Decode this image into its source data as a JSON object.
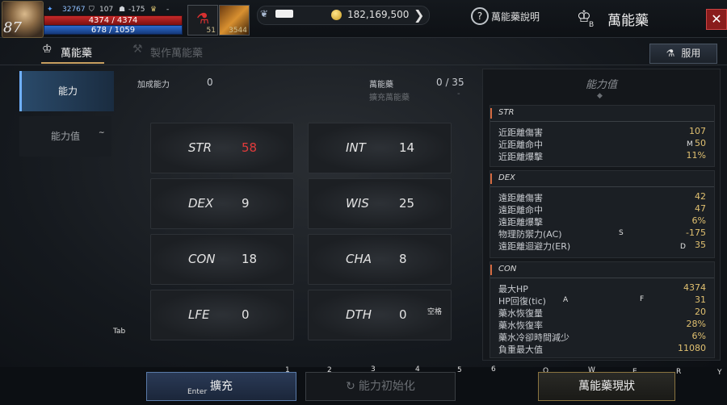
{
  "player": {
    "level": "87",
    "stat_a": "32767",
    "stat_b": "107",
    "stat_c": "-175",
    "stat_d": "-",
    "hp": "4374 / 4374",
    "mp": "678 / 1059"
  },
  "slots": [
    {
      "count": "51"
    },
    {
      "count": "3544"
    }
  ],
  "currency": {
    "gold": "182,169,500"
  },
  "header": {
    "help_label": "萬能藥說明",
    "title": "萬能藥",
    "close": "✕"
  },
  "tabs": {
    "active": "萬能藥",
    "inactive": "製作萬能藥",
    "use_button": "服用"
  },
  "sidenav": [
    {
      "label": "能力"
    },
    {
      "label": "能力值"
    }
  ],
  "info": {
    "bonus_label": "加成能力",
    "bonus_value": "0",
    "elixir_label": "萬能藥",
    "elixir_value": "0 / 35",
    "expand_label": "擴充萬能藥",
    "expand_value": "-"
  },
  "stats": [
    {
      "key": "STR",
      "value": "58"
    },
    {
      "key": "INT",
      "value": "14"
    },
    {
      "key": "DEX",
      "value": "9"
    },
    {
      "key": "WIS",
      "value": "25"
    },
    {
      "key": "CON",
      "value": "18"
    },
    {
      "key": "CHA",
      "value": "8"
    },
    {
      "key": "LFE",
      "value": "0"
    },
    {
      "key": "DTH",
      "value": "0"
    }
  ],
  "panel": {
    "title": "能力值",
    "sections": [
      {
        "name": "STR",
        "rows": [
          {
            "n": "近距離傷害",
            "v": "107"
          },
          {
            "n": "近距離命中",
            "v": "50"
          },
          {
            "n": "近距離爆擊",
            "v": "11%"
          }
        ]
      },
      {
        "name": "DEX",
        "rows": [
          {
            "n": "遠距離傷害",
            "v": "42"
          },
          {
            "n": "遠距離命中",
            "v": "47"
          },
          {
            "n": "遠距離爆擊",
            "v": "6%"
          },
          {
            "n": "物理防禦力(AC)",
            "v": "-175"
          },
          {
            "n": "遠距離迴避力(ER)",
            "v": "35"
          }
        ]
      },
      {
        "name": "CON",
        "rows": [
          {
            "n": "最大HP",
            "v": "4374"
          },
          {
            "n": "HP回復(tic)",
            "v": "31"
          },
          {
            "n": "藥水恢復量",
            "v": "20"
          },
          {
            "n": "藥水恢復率",
            "v": "28%"
          },
          {
            "n": "藥水冷卻時間減少",
            "v": "6%"
          },
          {
            "n": "負重最大值",
            "v": "11080"
          }
        ]
      }
    ]
  },
  "buttons": {
    "expand": "擴充",
    "reset": "能力初始化",
    "status": "萬能藥現狀"
  },
  "hints": {
    "b": "B",
    "tilde": "~",
    "m": "M",
    "s": "S",
    "d": "D",
    "a": "A",
    "f": "F",
    "space": "空格",
    "tab": "Tab",
    "enter": "Enter",
    "n1": "1",
    "n2": "2",
    "n3": "3",
    "n4": "4",
    "n5": "5",
    "n6": "6",
    "q": "Q",
    "w": "W",
    "e": "E",
    "r": "R",
    "y": "Y"
  }
}
